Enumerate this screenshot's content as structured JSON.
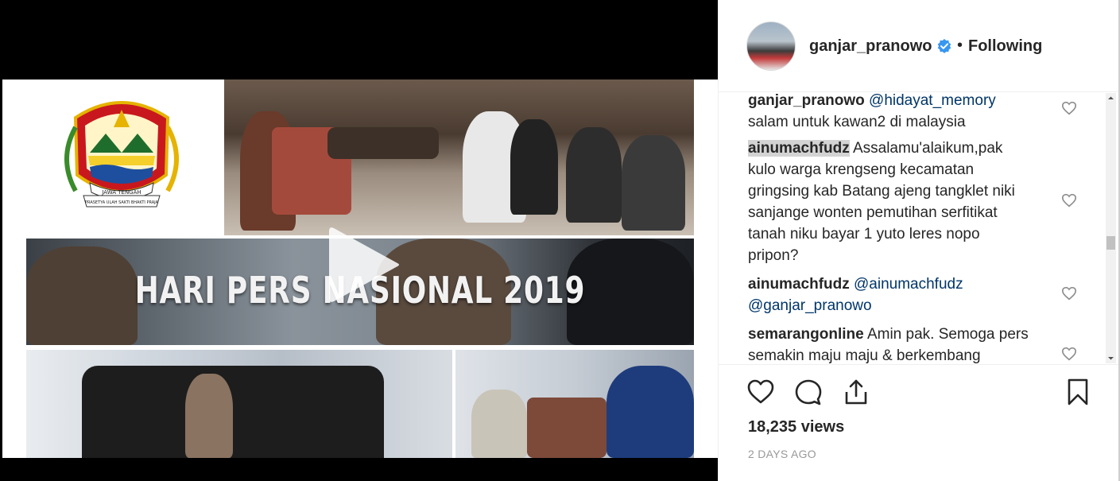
{
  "media": {
    "headline": "HARI PERS NASIONAL 2019",
    "logo_text": "JAWA TENGAH",
    "logo_motto": "PRASETYA ULAH SAKTI BHAKTI PRAJA"
  },
  "post": {
    "username": "ganjar_pranowo",
    "separator": "•",
    "follow_status": "Following",
    "views": "18,235 views",
    "time_ago": "2 DAYS AGO"
  },
  "comments": [
    {
      "author": "ganjar_pranowo",
      "mention": "@hidayat_memory",
      "text": "salam untuk kawan2 di malaysia"
    },
    {
      "author": "ainumachfudz",
      "text": "Assalamu'alaikum,pak kulo warga krengseng kecamatan gringsing kab Batang ajeng tangklet niki sanjange wonten pemutihan serfitikat tanah niku bayar 1 yuto leres nopo pripon?"
    },
    {
      "author": "ainumachfudz",
      "mention": "@ainumachfudz",
      "mention2": "@ganjar_pranowo"
    },
    {
      "author": "semarangonline",
      "text": "Amin pak. Semoga pers semakin maju maju & berkembang"
    }
  ],
  "colors": {
    "verified": "#3897f0",
    "mention": "#003569",
    "highlight": "#d3d3d3",
    "muted": "#999999"
  },
  "icons": [
    "play-icon",
    "verified-badge-icon",
    "heart-icon",
    "comment-icon",
    "share-icon",
    "bookmark-icon"
  ]
}
